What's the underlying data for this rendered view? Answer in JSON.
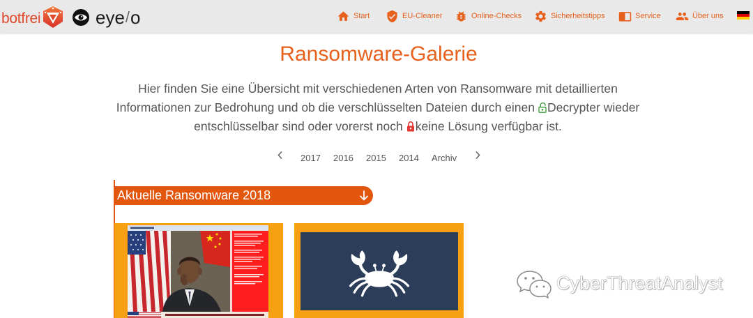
{
  "colors": {
    "accent": "#e8611c",
    "section_bar": "#e2560d",
    "card_border": "#f6a012",
    "navy": "#2c3d59",
    "text": "#555555",
    "nav_bg": "#e9e9e9",
    "logo_red": "#e0482c",
    "decrypter_green": "#3a9a3a",
    "lock_red": "#e53935"
  },
  "brand": {
    "botfrei": "botfrei",
    "botfrei_icon": "botfrei-shield-icon",
    "eyeo_icon": "eye-icon",
    "eyeo": [
      "eye",
      "/",
      "o"
    ]
  },
  "nav": {
    "items": [
      {
        "label": "Start",
        "icon": "home-icon"
      },
      {
        "label": "EU-Cleaner",
        "icon": "shield-check-icon"
      },
      {
        "label": "Online-Checks",
        "icon": "bug-icon"
      },
      {
        "label": "Sicherheitstipps",
        "icon": "gear-icon"
      },
      {
        "label": "Service",
        "icon": "book-icon"
      },
      {
        "label": "Über uns",
        "icon": "users-icon"
      }
    ],
    "language_icon": "german-flag-icon"
  },
  "page_title": "Ransomware-Galerie",
  "intro": {
    "line1": "Hier finden Sie eine Übersicht mit verschiedenen Arten von Ransomware mit detaillierten",
    "line2_before": "Informationen zur Bedrohung und ob die verschlüsselten Dateien durch einen",
    "decrypter_icon": "unlock-icon",
    "line2_after": "Decrypter wieder",
    "line3_before": "entschlüsselbar sind oder vorerst noch",
    "no_solution_icon": "lock-icon",
    "line3_after": "keine Lösung verfügbar ist."
  },
  "year_nav": {
    "prev_icon": "chevron-left-icon",
    "items": [
      "2017",
      "2016",
      "2015",
      "2014",
      "Archiv"
    ],
    "next_icon": "chevron-right-icon"
  },
  "section": {
    "title": "Aktuelle Ransomware 2018",
    "toggle_icon": "arrow-down-icon"
  },
  "gallery": {
    "cards": [
      {
        "icon": "ransom-note-thumbnail"
      },
      {
        "icon": "crab-icon"
      }
    ]
  },
  "watermark": {
    "icon": "wechat-icon",
    "text": "CyberThreatAnalyst"
  }
}
